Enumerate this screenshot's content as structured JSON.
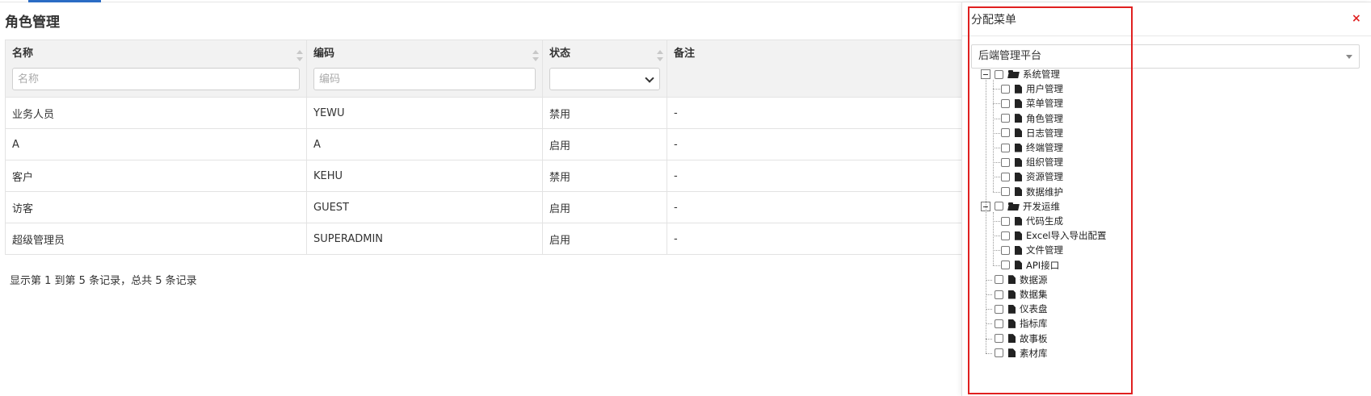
{
  "page": {
    "title": "角色管理"
  },
  "table": {
    "columns": [
      {
        "label": "名称",
        "filter_placeholder": "名称"
      },
      {
        "label": "编码",
        "filter_placeholder": "编码"
      },
      {
        "label": "状态",
        "filter_placeholder": ""
      },
      {
        "label": "备注",
        "filter_placeholder": ""
      }
    ],
    "rows": [
      {
        "name": "业务人员",
        "code": "YEWU",
        "status": "禁用",
        "remark": "-"
      },
      {
        "name": "A",
        "code": "A",
        "status": "启用",
        "remark": "-"
      },
      {
        "name": "客户",
        "code": "KEHU",
        "status": "禁用",
        "remark": "-"
      },
      {
        "name": "访客",
        "code": "GUEST",
        "status": "启用",
        "remark": "-"
      },
      {
        "name": "超级管理员",
        "code": "SUPERADMIN",
        "status": "启用",
        "remark": "-"
      }
    ],
    "pager_text": "显示第 1 到第 5 条记录，总共 5 条记录"
  },
  "colors": {
    "status_off": "#e06666",
    "status_on": "#5cb85c",
    "highlight": "#e02020",
    "accent": "#2b6cc4"
  },
  "panel": {
    "title": "分配菜单",
    "close": "×",
    "platform": "后端管理平台",
    "tree": [
      {
        "label": "系统管理",
        "icon": "folder-open-icon",
        "children": [
          "用户管理",
          "菜单管理",
          "角色管理",
          "日志管理",
          "终端管理",
          "组织管理",
          "资源管理",
          "数据维护"
        ]
      },
      {
        "label": "开发运维",
        "icon": "folder-open-icon",
        "children": [
          "代码生成",
          "Excel导入导出配置",
          "文件管理",
          "API接口"
        ]
      },
      {
        "label": "数据源",
        "icon": "file-icon"
      },
      {
        "label": "数据集",
        "icon": "file-icon"
      },
      {
        "label": "仪表盘",
        "icon": "file-icon"
      },
      {
        "label": "指标库",
        "icon": "file-icon"
      },
      {
        "label": "故事板",
        "icon": "file-icon"
      },
      {
        "label": "素材库",
        "icon": "file-icon"
      }
    ]
  }
}
